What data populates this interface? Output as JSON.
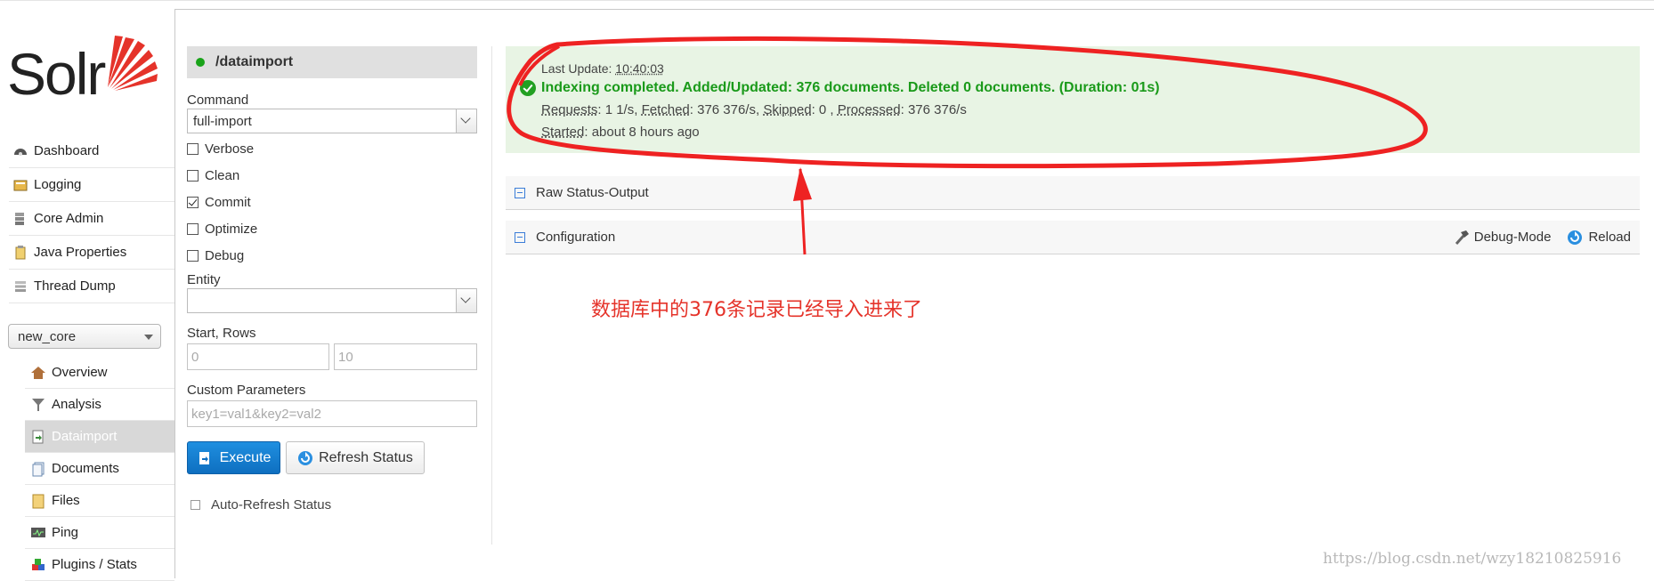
{
  "brand": {
    "logo_text": "Solr",
    "accent": "#e5332a"
  },
  "sidebar": {
    "items": [
      {
        "label": "Dashboard",
        "icon": "dashboard-icon"
      },
      {
        "label": "Logging",
        "icon": "logging-icon"
      },
      {
        "label": "Core Admin",
        "icon": "core-admin-icon"
      },
      {
        "label": "Java Properties",
        "icon": "java-properties-icon"
      },
      {
        "label": "Thread Dump",
        "icon": "thread-dump-icon"
      }
    ],
    "core_selector": "new_core",
    "core_items": [
      {
        "label": "Overview",
        "icon": "home-icon"
      },
      {
        "label": "Analysis",
        "icon": "funnel-icon"
      },
      {
        "label": "Dataimport",
        "icon": "dataimport-icon",
        "active": true
      },
      {
        "label": "Documents",
        "icon": "documents-icon"
      },
      {
        "label": "Files",
        "icon": "folder-icon"
      },
      {
        "label": "Ping",
        "icon": "ping-icon"
      },
      {
        "label": "Plugins / Stats",
        "icon": "plugins-icon"
      }
    ]
  },
  "form": {
    "handler": "/dataimport",
    "command_label": "Command",
    "command_value": "full-import",
    "options": [
      {
        "label": "Verbose",
        "checked": false
      },
      {
        "label": "Clean",
        "checked": false
      },
      {
        "label": "Commit",
        "checked": true
      },
      {
        "label": "Optimize",
        "checked": false
      },
      {
        "label": "Debug",
        "checked": false
      }
    ],
    "entity_label": "Entity",
    "entity_value": "",
    "start_rows_label": "Start, Rows",
    "start_placeholder": "0",
    "rows_placeholder": "10",
    "custom_params_label": "Custom Parameters",
    "custom_params_placeholder": "key1=val1&key2=val2",
    "execute_label": "Execute",
    "refresh_label": "Refresh Status",
    "auto_refresh_label": "Auto-Refresh Status"
  },
  "status": {
    "last_update_label": "Last Update:",
    "last_update_time": "10:40:03",
    "message": "Indexing completed. Added/Updated: 376 documents. Deleted 0 documents. (Duration: 01s)",
    "requests_label": "Requests",
    "requests_value": ": 1 1/s, ",
    "fetched_label": "Fetched",
    "fetched_value": ": 376 376/s, ",
    "skipped_label": "Skipped",
    "skipped_value": ": 0 , ",
    "processed_label": "Processed",
    "processed_value": ": 376 376/s",
    "started_label": "Started",
    "started_value": ": about 8 hours ago"
  },
  "sections": {
    "raw": "Raw Status-Output",
    "config": "Configuration",
    "debug_mode": "Debug-Mode",
    "reload": "Reload"
  },
  "annotation": {
    "text": "数据库中的376条记录已经导入进来了",
    "color": "#e5332a"
  },
  "watermark": "https://blog.csdn.net/wzy18210825916"
}
